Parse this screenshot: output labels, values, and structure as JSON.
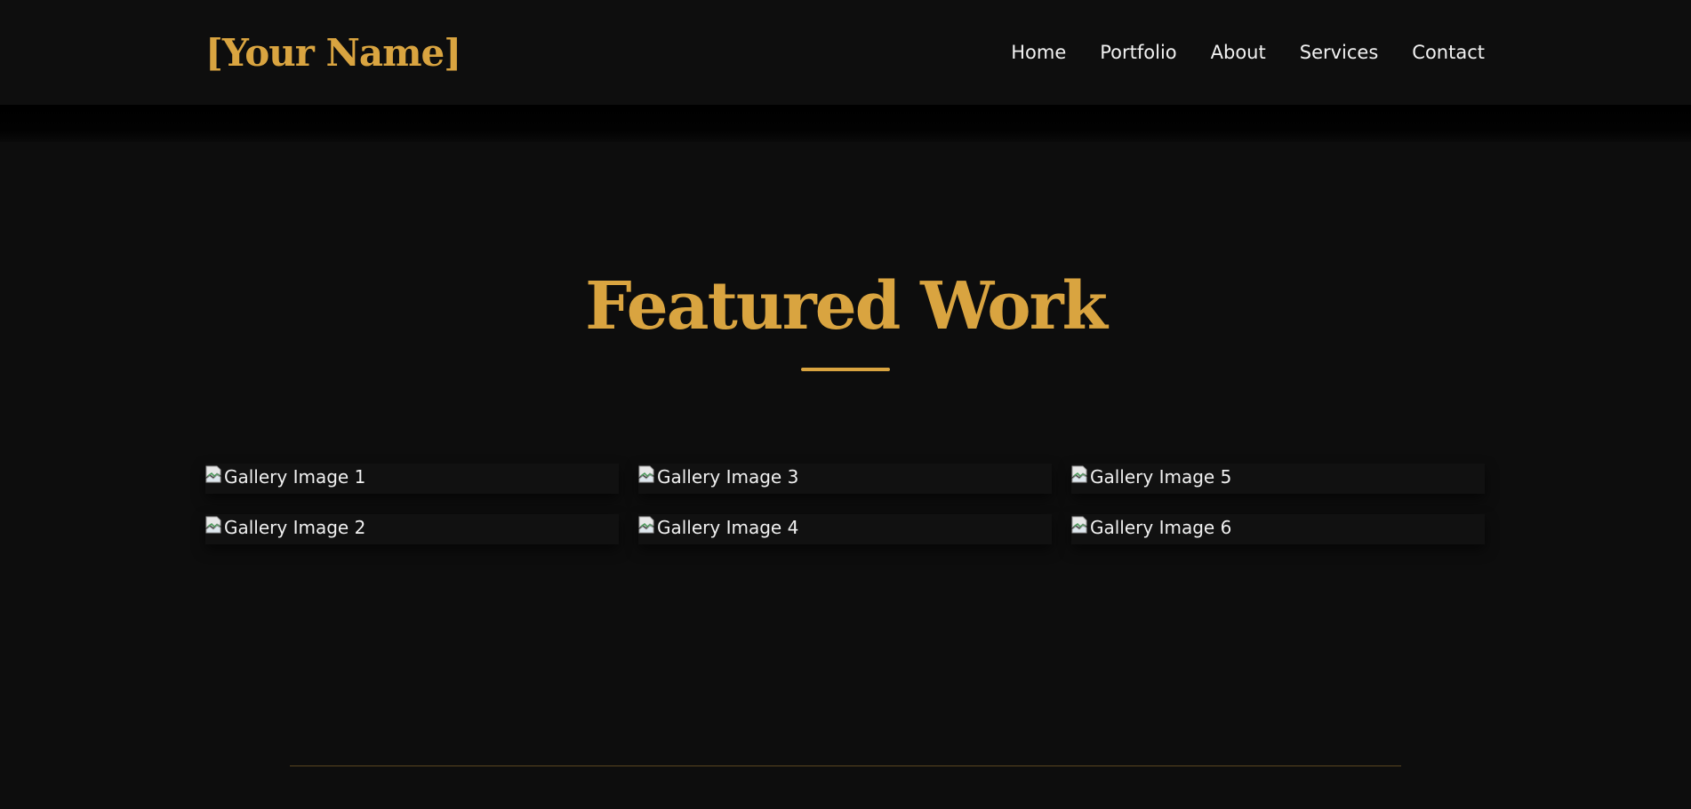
{
  "brand": {
    "name": "[Your Name]"
  },
  "nav": {
    "items": [
      {
        "label": "Home"
      },
      {
        "label": "Portfolio"
      },
      {
        "label": "About"
      },
      {
        "label": "Services"
      },
      {
        "label": "Contact"
      }
    ]
  },
  "featured": {
    "title": "Featured Work",
    "images": [
      {
        "alt": "Gallery Image 1",
        "icon": "broken-image-icon"
      },
      {
        "alt": "Gallery Image 2",
        "icon": "broken-image-icon"
      },
      {
        "alt": "Gallery Image 3",
        "icon": "broken-image-icon"
      },
      {
        "alt": "Gallery Image 4",
        "icon": "broken-image-icon"
      },
      {
        "alt": "Gallery Image 5",
        "icon": "broken-image-icon"
      },
      {
        "alt": "Gallery Image 6",
        "icon": "broken-image-icon"
      }
    ]
  },
  "colors": {
    "background": "#0d0d0d",
    "accent": "#d9a440",
    "text": "#f2f2f2"
  }
}
